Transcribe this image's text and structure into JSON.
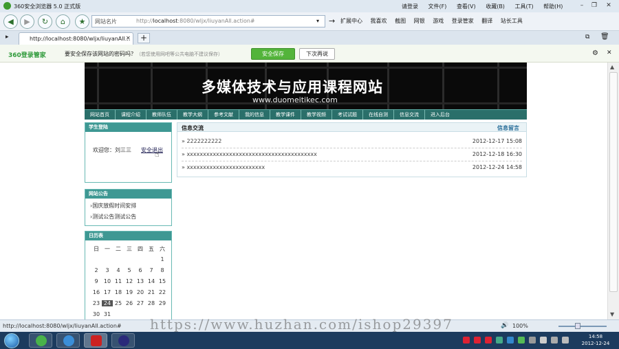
{
  "browser": {
    "title": "360安全浏览器 5.0 正式版",
    "menu": [
      "请登录",
      "文件(F)",
      "查看(V)",
      "收藏(B)",
      "工具(T)",
      "帮助(H)"
    ],
    "site_dropdown": "网站名片",
    "address_prefix": "http://",
    "address_host": "localhost",
    "address_path": ":8080/wljx/liuyanAll.action#",
    "toolbar_items": [
      "扩展中心",
      "我喜欢",
      "截图",
      "网银",
      "游戏",
      "登录管家",
      "翻译",
      "站长工具"
    ],
    "tab_title": "http://localhost:8080/wljx/liuyanAll...",
    "newtab_label": "+"
  },
  "password_bar": {
    "brand": "360登录管家",
    "question": "要安全保存该网站的密码吗？",
    "note": "（若您使用网吧等公共电脑不建议保存）",
    "save_label": "安全保存",
    "later_label": "下次再说"
  },
  "site": {
    "banner_title": "多媒体技术与应用课程网站",
    "banner_url": "www.duomeitikec.com",
    "nav": [
      "网站首页",
      "课程介绍",
      "教师队伍",
      "教学大纲",
      "参考文献",
      "我的信息",
      "教学课件",
      "教学视频",
      "考试试题",
      "在线自测",
      "信息交流",
      "进入后台"
    ]
  },
  "login": {
    "header": "学生登陆",
    "welcome": "欢迎您：",
    "user": "刘三三",
    "logout": "安全退出"
  },
  "notice": {
    "header": "网站公告",
    "items": [
      "国庆放假时间安排",
      "测试公告测试公告"
    ]
  },
  "calendar": {
    "header": "日历表",
    "weekdays": [
      "日",
      "一",
      "二",
      "三",
      "四",
      "五",
      "六"
    ],
    "rows": [
      [
        "",
        "",
        "",
        "",
        "",
        "",
        "1"
      ],
      [
        "2",
        "3",
        "4",
        "5",
        "6",
        "7",
        "8"
      ],
      [
        "9",
        "10",
        "11",
        "12",
        "13",
        "14",
        "15"
      ],
      [
        "16",
        "17",
        "18",
        "19",
        "20",
        "21",
        "22"
      ],
      [
        "23",
        "24",
        "25",
        "26",
        "27",
        "28",
        "29"
      ],
      [
        "30",
        "31",
        "",
        "",
        "",
        "",
        ""
      ]
    ],
    "today": "24"
  },
  "messages": {
    "header": "信息交流",
    "action": "信息留言",
    "rows": [
      {
        "title": "2222222222",
        "date": "2012-12-17 15:08"
      },
      {
        "title": "xxxxxxxxxxxxxxxxxxxxxxxxxxxxxxxxxxxxxxxx",
        "date": "2012-12-18 16:30"
      },
      {
        "title": "xxxxxxxxxxxxxxxxxxxxxxxx",
        "date": "2012-12-24 14:58"
      }
    ]
  },
  "status": {
    "url": "http://localhost:8080/wljx/liuyanAll.action#",
    "watermark": "https://www.huzhan.com/ishop29397",
    "zoom": "100%"
  },
  "taskbar": {
    "time": "14:58",
    "date": "2012-12-24"
  },
  "colors": {
    "site_teal": "#3e9893",
    "save_green": "#53b43a",
    "taskbar": "#1c3b5e"
  }
}
